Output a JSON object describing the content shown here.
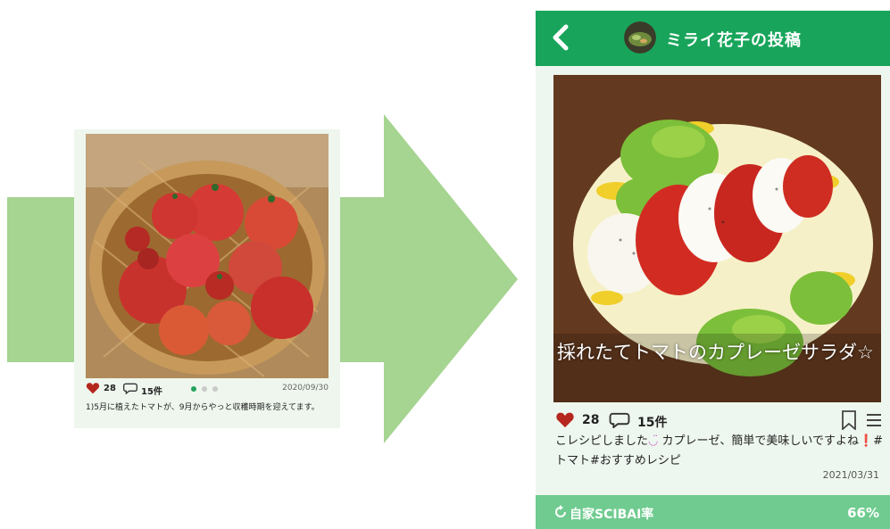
{
  "left_post": {
    "likes": "28",
    "comments": "15件",
    "date": "2020/09/30",
    "caption": "1)5月に植えたトマトが、9月からやっと収穫時期を迎えてます。",
    "carousel": {
      "count": 3,
      "active": 1
    }
  },
  "phone": {
    "header": {
      "title": "ミライ花子の投稿"
    },
    "photo_title": "採れたてトマトのカプレーゼサラダ☆",
    "likes": "28",
    "comments": "15件",
    "caption_part1": "こレシピしました",
    "caption_smile": "◡̈",
    "caption_part2": " カプレーゼ、簡単で美味しいですよね",
    "caption_exclaim": "❗",
    "caption_part3": "#トマト#おすすめレシピ",
    "date": "2021/03/31",
    "footer": {
      "label": "自家SCIBAI率",
      "value": "66%"
    }
  },
  "colors": {
    "brand_green": "#18a55b",
    "light_green": "#6fcb8f",
    "arrow_green": "#a6d491",
    "heart_red": "#b5271e"
  },
  "icons": [
    "chevron-left-icon",
    "heart-icon",
    "comment-icon",
    "bookmark-icon",
    "menu-icon",
    "refresh-icon"
  ]
}
